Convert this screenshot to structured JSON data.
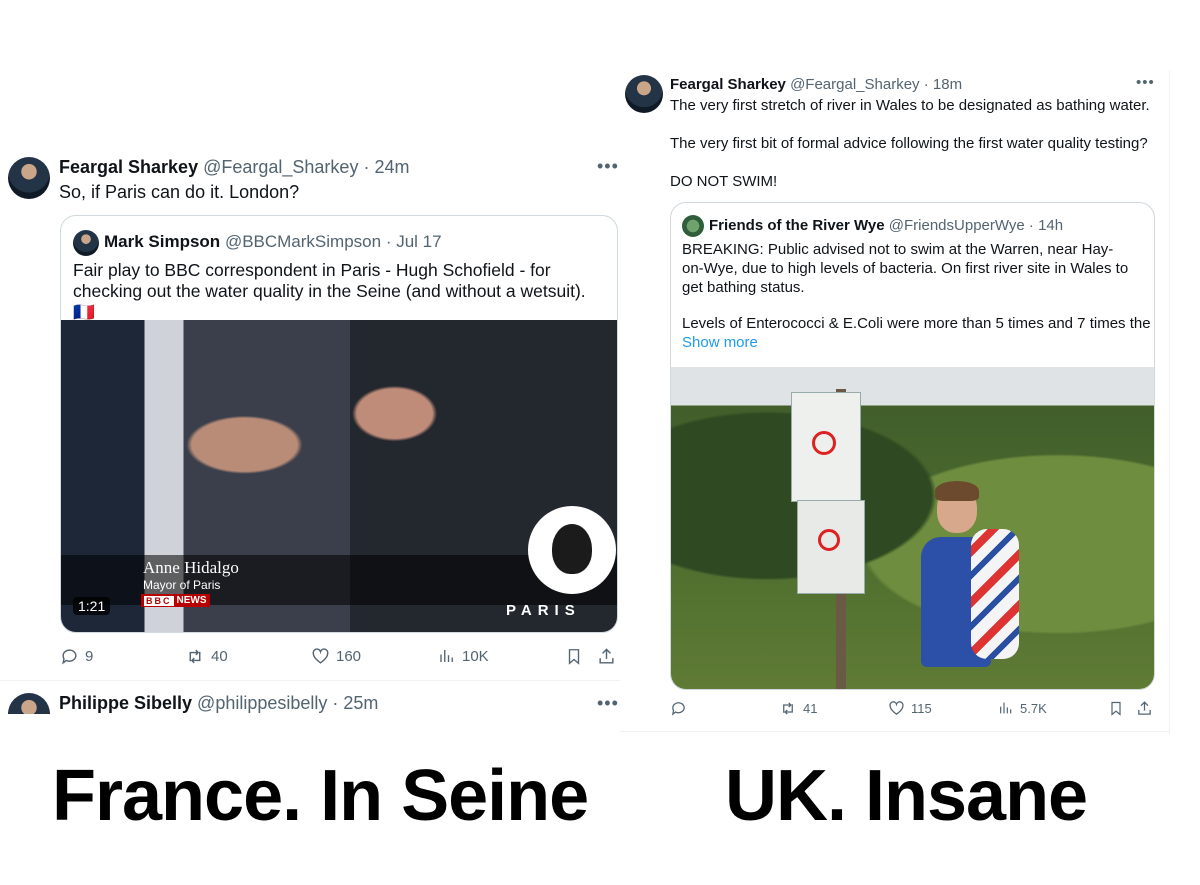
{
  "left_tweet": {
    "author_name": "Feargal Sharkey",
    "author_handle": "@Feargal_Sharkey",
    "time": "· 24m",
    "text": "So, if Paris can do it. London?",
    "quote": {
      "author_name": "Mark Simpson",
      "author_handle": "@BBCMarkSimpson",
      "time": "· Jul 17",
      "text": "Fair play to BBC correspondent in Paris - Hugh Schofield - for checking out the water quality in the Seine (and without a wetsuit).🇫🇷",
      "video": {
        "caption_name": "Anne Hidalgo",
        "caption_title": "Mayor of Paris",
        "bbc_letters": "BBC",
        "news_label": "NEWS",
        "duration": "1:21",
        "paris_label": "PARIS"
      }
    },
    "stats": {
      "replies": "9",
      "reposts": "40",
      "likes": "160",
      "views": "10K"
    }
  },
  "left_next_tweet": {
    "author_name": "Philippe Sibelly",
    "author_handle": "@philippesibelly",
    "time": "· 25m"
  },
  "right_tweet": {
    "author_name": "Feargal Sharkey",
    "author_handle": "@Feargal_Sharkey",
    "time": "· 18m",
    "line1": "The very first stretch of river in Wales to be designated as bathing water.",
    "line2": "The very first bit of formal advice following the first water quality testing?",
    "line3": "DO NOT SWIM!",
    "quote": {
      "author_name": "Friends of the River Wye",
      "author_handle": "@FriendsUpperWye",
      "time": "· 14h",
      "para1": "BREAKING: Public advised not to swim at the Warren, near Hay-on-Wye, due to high levels of bacteria. On first river site in Wales to get bathing status.",
      "para2": "Levels of Enterococci & E.Coli were more than 5 times and 7 times the",
      "show_more": "Show more"
    },
    "stats": {
      "reposts": "41",
      "likes": "115",
      "views": "5.7K"
    }
  },
  "captions": {
    "left": "France. In Seine",
    "right": "UK. Insane"
  },
  "colors": {
    "link": "#1d9bf0",
    "muted": "#536471",
    "bbc_red": "#b80000"
  }
}
